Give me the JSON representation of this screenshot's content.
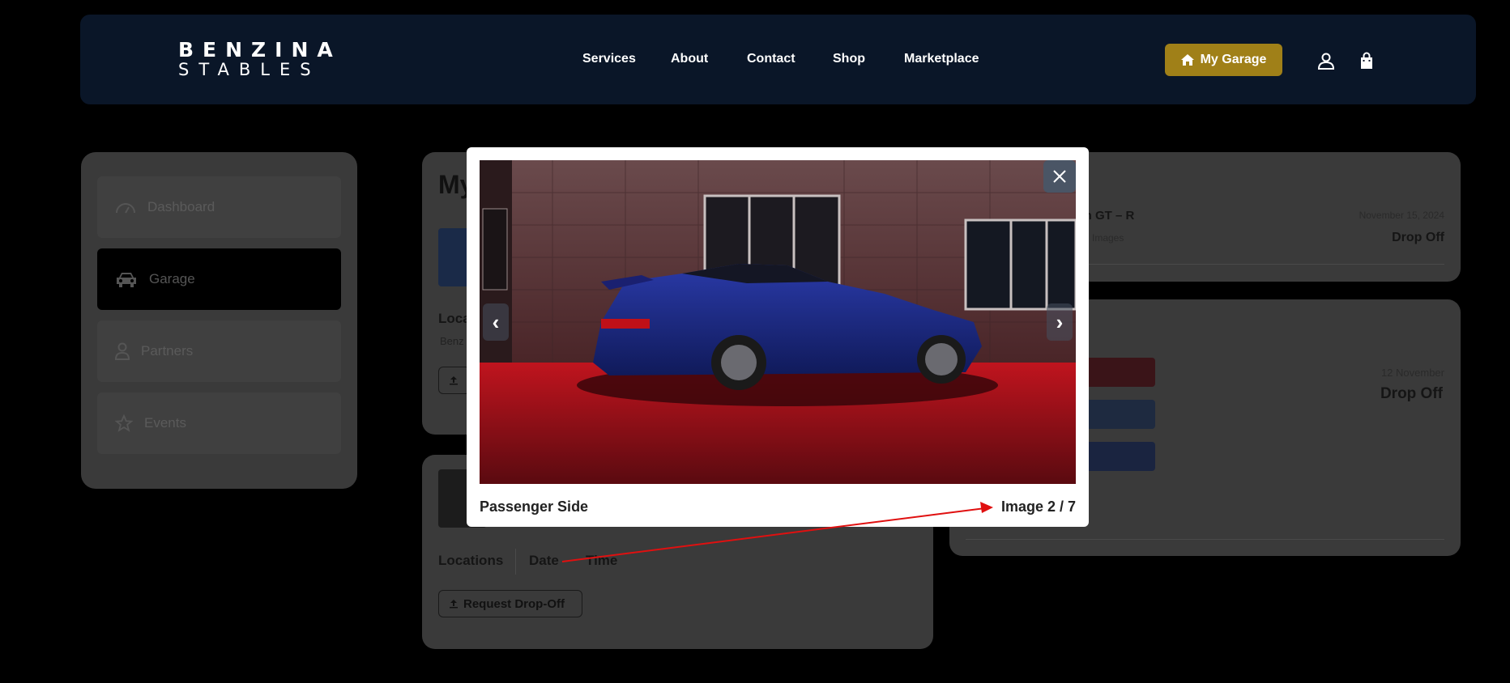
{
  "header": {
    "logo_line1": "BENZINA",
    "logo_line2": "STABLES",
    "nav": [
      "Services",
      "About",
      "Contact",
      "Shop",
      "Marketplace"
    ],
    "my_garage_label": "My Garage"
  },
  "sidebar": {
    "items": [
      {
        "label": "Dashboard",
        "icon": "gauge-icon"
      },
      {
        "label": "Garage",
        "icon": "car-icon"
      },
      {
        "label": "Partners",
        "icon": "person-icon"
      },
      {
        "label": "Events",
        "icon": "star-icon"
      }
    ]
  },
  "main": {
    "card1": {
      "title": "My",
      "locations_label": "Loca",
      "sub_text": "Benz"
    },
    "card2": {
      "locations_label": "Locations",
      "date_label": "Date",
      "time_label": "Time",
      "button_label": "Request Drop-Off"
    }
  },
  "right": {
    "card1": {
      "car_name": "san GT – R",
      "images_label": "Images",
      "date": "November 15, 2024",
      "status": "Drop Off"
    },
    "card2": {
      "date": "12 November",
      "status": "Drop Off"
    }
  },
  "modal": {
    "caption": "Passenger Side",
    "counter": "Image 2 / 7",
    "current_index": 2,
    "total": 7
  },
  "colors": {
    "header_bg": "#0a1628",
    "accent_gold": "#a08018",
    "annotation_arrow": "#e01010"
  }
}
